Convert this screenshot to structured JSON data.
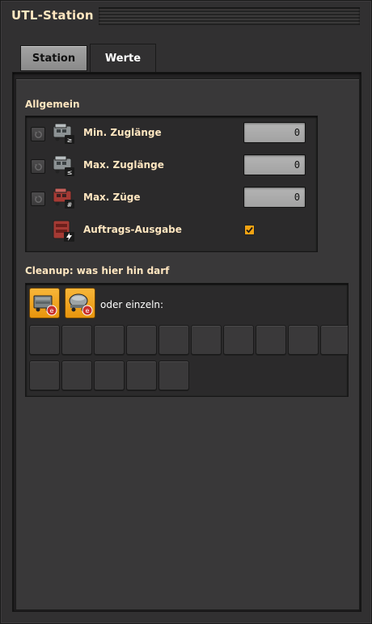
{
  "window": {
    "title": "UTL-Station"
  },
  "tabs": [
    {
      "label": "Station",
      "selected": false
    },
    {
      "label": "Werte",
      "selected": true
    }
  ],
  "general": {
    "title": "Allgemein",
    "rows": [
      {
        "label": "Min. Zuglänge",
        "value": "0",
        "icon": "locomotive-greater-equal-icon"
      },
      {
        "label": "Max. Zuglänge",
        "value": "0",
        "icon": "locomotive-less-equal-icon"
      },
      {
        "label": "Max. Züge",
        "value": "0",
        "icon": "locomotive-count-icon"
      }
    ],
    "output": {
      "label": "Auftrags-Ausgabe",
      "checked": true,
      "icon": "output-signal-icon"
    }
  },
  "cleanup": {
    "title": "Cleanup: was hier hin darf",
    "filters": [
      "cargo-wagon-icon",
      "fluid-wagon-icon"
    ],
    "or_label": "oder einzeln:"
  },
  "colors": {
    "title_text": "#ffe6c0",
    "accent": "#f3a312",
    "panel_bg": "#393839",
    "field_bg": "#a8a8a8"
  }
}
